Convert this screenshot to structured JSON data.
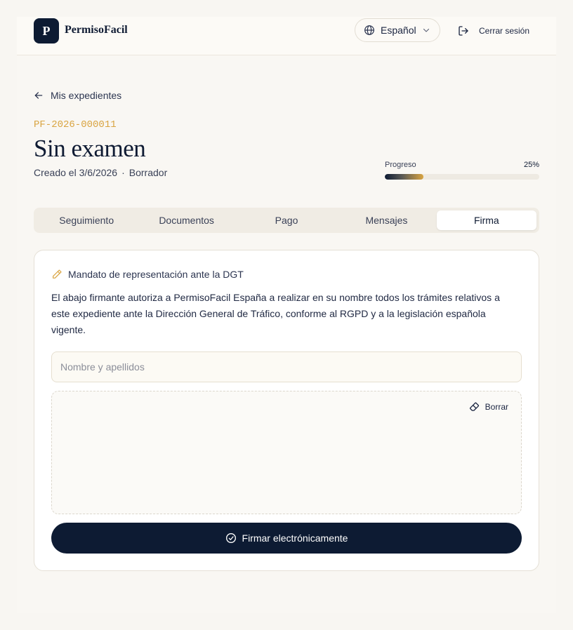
{
  "header": {
    "logo_letter": "P",
    "brand": "PermisoFacil",
    "language": "Español",
    "logout_label": "Cerrar sesión"
  },
  "nav": {
    "back_label": "Mis expedientes"
  },
  "case": {
    "id": "PF-2026-000011",
    "title": "Sin examen",
    "created": "Creado el 3/6/2026",
    "separator": "·",
    "status": "Borrador"
  },
  "progress": {
    "label": "Progreso",
    "value_text": "25%",
    "value": 0.25
  },
  "tabs": [
    {
      "label": "Seguimiento",
      "active": false
    },
    {
      "label": "Documentos",
      "active": false
    },
    {
      "label": "Pago",
      "active": false
    },
    {
      "label": "Mensajes",
      "active": false
    },
    {
      "label": "Firma",
      "active": true
    }
  ],
  "signature": {
    "heading": "Mandato de representación ante la DGT",
    "mandate_text": "El abajo firmante autoriza a PermisoFacil España a realizar en su nombre todos los trámites relativos a este expediente ante la Dirección General de Tráfico, conforme al RGPD y a la legislación española vigente.",
    "name_placeholder": "Nombre y apellidos",
    "name_value": "",
    "clear_label": "Borrar",
    "sign_label": "Firmar electrónicamente"
  },
  "colors": {
    "navy": "#0d1b33",
    "accent_gold": "#d9a441",
    "background": "#f8f6f2"
  },
  "icons": [
    "globe-icon",
    "chevron-down-icon",
    "logout-icon",
    "arrow-left-icon",
    "pencil-icon",
    "eraser-icon",
    "check-circle-icon"
  ]
}
